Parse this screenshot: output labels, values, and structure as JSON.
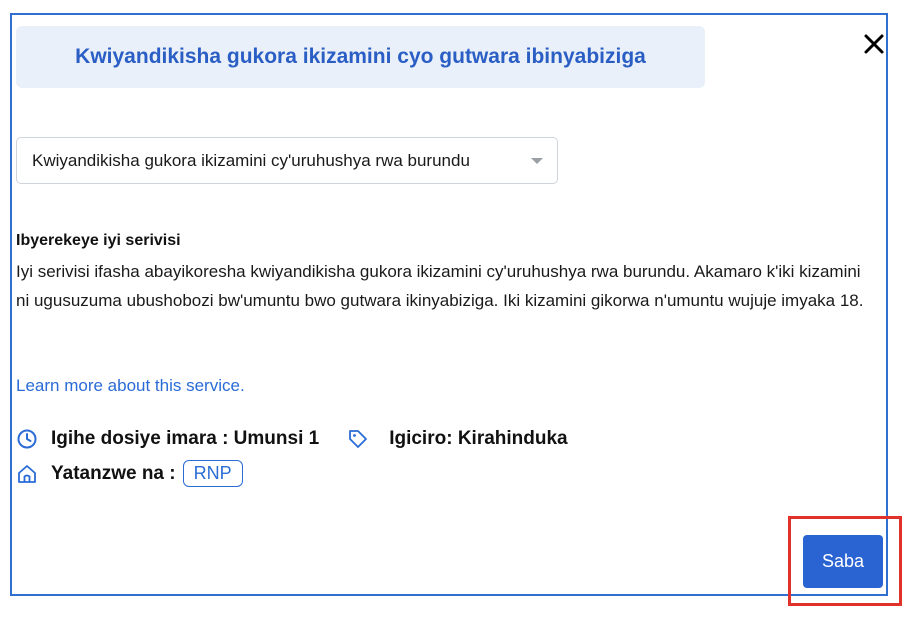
{
  "dialog": {
    "title": "Kwiyandikisha gukora ikizamini cyo gutwara ibinyabiziga",
    "selected_service": "Kwiyandikisha gukora ikizamini cy'uruhushya rwa burundu",
    "about_heading": "Ibyerekeye iyi serivisi",
    "about_text": "Iyi serivisi ifasha abayikoresha kwiyandikisha gukora ikizamini cy'uruhushya rwa burundu. Akamaro k'iki kizamini ni ugusuzuma ubushobozi bw'umuntu bwo gutwara ikinyabiziga. Iki kizamini gikorwa n'umuntu wujuje imyaka 18.",
    "learn_more": "Learn more about this service.",
    "processing_time": "Igihe dosiye imara : Umunsi 1",
    "price": "Igiciro: Kirahinduka",
    "provider_label": "Yatanzwe na :",
    "provider_badge": "RNP",
    "submit_label": "Saba",
    "close_icon": "close-icon"
  },
  "colors": {
    "accent": "#2a63d2",
    "title_bg": "#e9f0fa",
    "frame_border": "#2f6fd0",
    "highlight": "#e0312b"
  }
}
